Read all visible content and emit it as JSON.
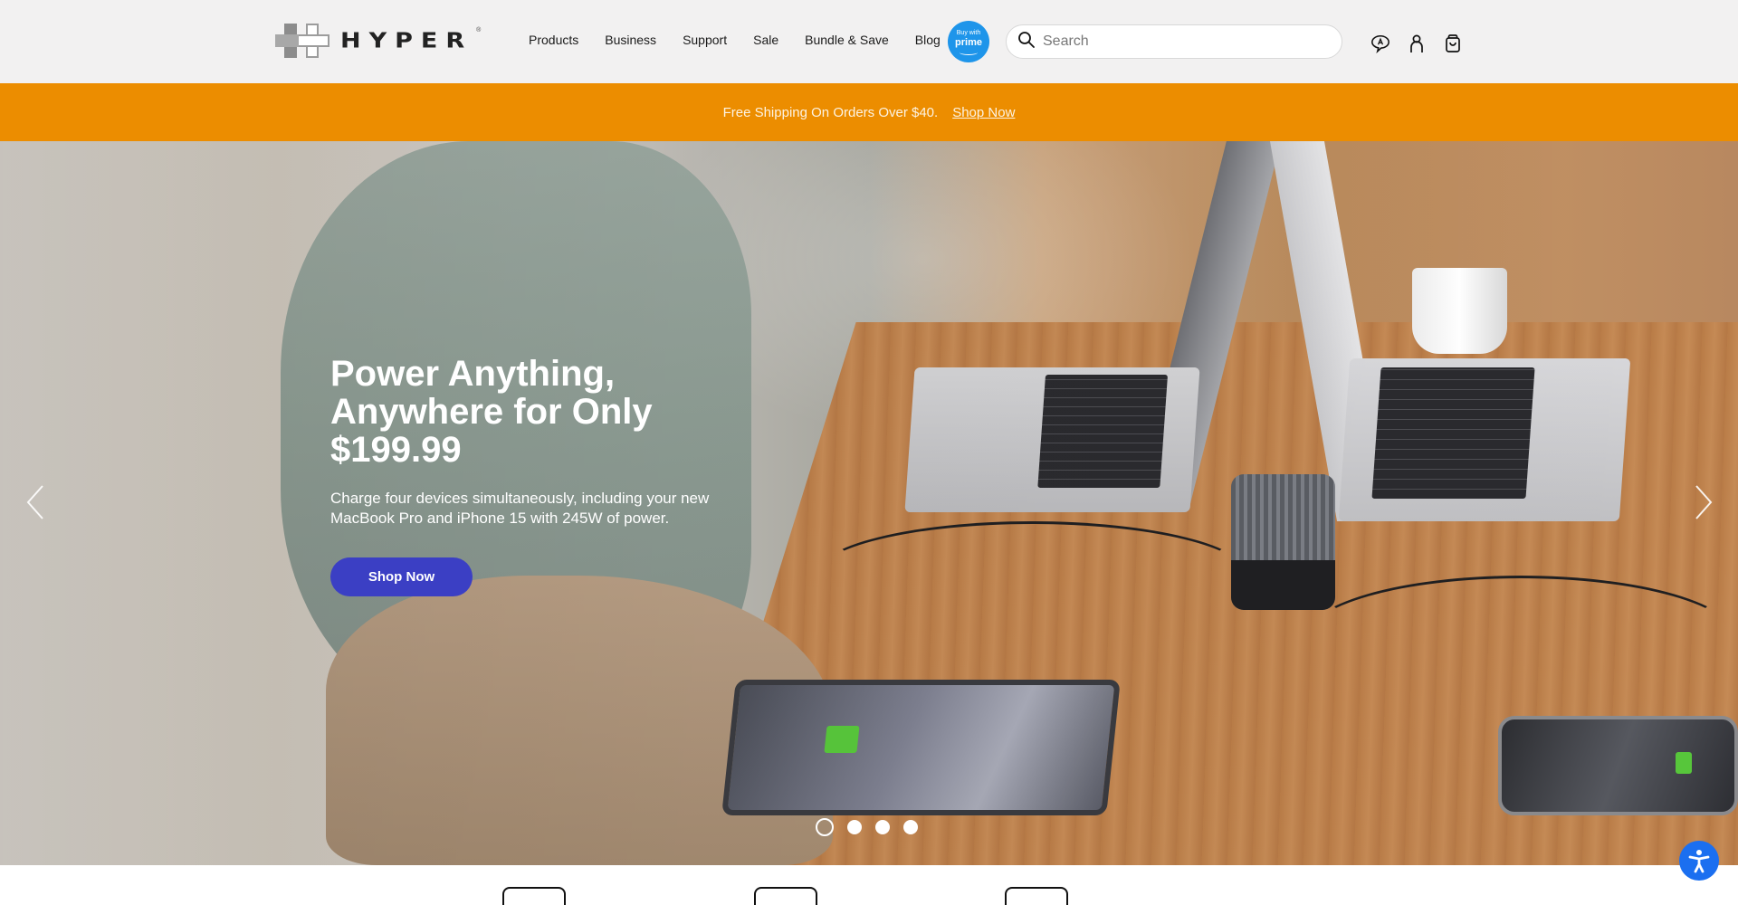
{
  "header": {
    "logo_text": "HYPER",
    "logo_reg": "®",
    "nav": [
      {
        "label": "Products"
      },
      {
        "label": "Business"
      },
      {
        "label": "Support"
      },
      {
        "label": "Sale"
      },
      {
        "label": "Bundle & Save"
      },
      {
        "label": "Blog"
      }
    ],
    "prime_badge": {
      "top": "Buy with",
      "bottom": "prime",
      "color": "#1e95ea"
    },
    "search": {
      "placeholder": "Search",
      "value": "",
      "icon": "search-icon"
    },
    "icons": [
      "chat-support-icon",
      "account-icon",
      "shopping-bag-icon"
    ]
  },
  "promo": {
    "message": "Free Shipping On Orders Over $40.",
    "link_label": "Shop Now",
    "background": "#ec8d00"
  },
  "hero": {
    "title": "Power Anything,\nAnywhere for Only\n$199.99",
    "subtitle": "Charge four devices simultaneously, including your new\nMacBook Pro and iPhone 15 with 245W of power.",
    "cta_label": "Shop Now",
    "cta_color": "#3b3fc4",
    "prev_icon": "chevron-left-icon",
    "next_icon": "chevron-right-icon",
    "slides_total": 4,
    "active_slide": 1
  },
  "accessibility": {
    "icon": "accessibility-icon",
    "color": "#1b6ff0"
  }
}
